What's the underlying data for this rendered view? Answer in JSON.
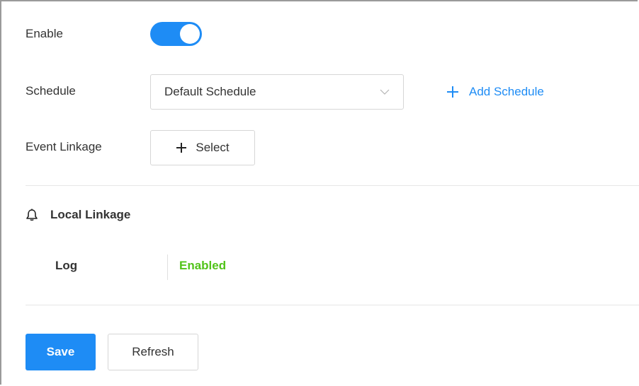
{
  "form": {
    "enable": {
      "label": "Enable",
      "state": "on",
      "color": "#1e8cf5"
    },
    "schedule": {
      "label": "Schedule",
      "selected_value": "Default Schedule",
      "add_link": "Add Schedule",
      "dropdown_icon": "chevron-down-icon",
      "add_icon": "plus-icon"
    },
    "event_linkage": {
      "label": "Event Linkage",
      "button_label": "Select",
      "button_icon": "plus-icon"
    }
  },
  "local_linkage": {
    "title": "Local Linkage",
    "icon": "bell-icon",
    "items": [
      {
        "label": "Log",
        "status": "Enabled",
        "status_color": "#52c41a"
      }
    ]
  },
  "actions": {
    "save_label": "Save",
    "refresh_label": "Refresh",
    "primary_color": "#1e8cf5"
  }
}
